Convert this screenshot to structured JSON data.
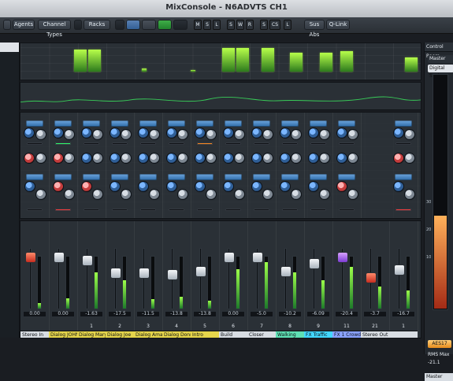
{
  "window": {
    "title": "MixConsole - N6ADVTS CH1"
  },
  "toolbar": {
    "agents": "Agents",
    "channel_types": "Channel Types",
    "racks": "Racks",
    "sus_abs": "Sus Abs",
    "q_link": "Q-Link",
    "mini_buttons": [
      "M",
      "S",
      "L",
      "S",
      "W",
      "R",
      "S",
      "CS",
      "L"
    ]
  },
  "right_panel": {
    "title": "Control Room",
    "master": "Master",
    "meter_type": "Digital Scale",
    "meter_marks": [
      "30",
      "20",
      "10"
    ],
    "aes": "AES17",
    "rms": "RMS Max",
    "rms_value": "-21.1",
    "bottom_label": "Master"
  },
  "channels": [
    {
      "name": "Stereo In",
      "number": "",
      "readout": "0.00",
      "cap": "red",
      "meter": 0.1
    },
    {
      "name": "Dialog JOHN",
      "number": "",
      "readout": "0.00",
      "cap": "white",
      "meter": 0.2
    },
    {
      "name": "Dialog Mary",
      "number": "1",
      "readout": "-1.63",
      "cap": "white",
      "meter": 0.7
    },
    {
      "name": "Dialog Joe",
      "number": "2",
      "readout": "-17.5",
      "cap": "white",
      "meter": 0.55
    },
    {
      "name": "Dialog Amad",
      "number": "3",
      "readout": "-11.5",
      "cap": "white",
      "meter": 0.18
    },
    {
      "name": "Dialog Donny",
      "number": "4",
      "readout": "-13.8",
      "cap": "white",
      "meter": 0.22
    },
    {
      "name": "Intro",
      "number": "5",
      "readout": "-13.8",
      "cap": "white",
      "meter": 0.15
    },
    {
      "name": "Build",
      "number": "6",
      "readout": "0.00",
      "cap": "white",
      "meter": 0.75
    },
    {
      "name": "Closer",
      "number": "7",
      "readout": "-5.0",
      "cap": "white",
      "meter": 0.9
    },
    {
      "name": "Walking",
      "number": "8",
      "readout": "-10.2",
      "cap": "white",
      "meter": 0.7
    },
    {
      "name": "FX Traffic",
      "number": "9",
      "readout": "-6.09",
      "cap": "white",
      "meter": 0.55
    },
    {
      "name": "FX 1 Crowd",
      "number": "11",
      "readout": "-20.4",
      "cap": "purple",
      "meter": 0.8
    },
    {
      "name": "Stereo Out",
      "number": "21",
      "readout": "-3.7",
      "cap": "red",
      "meter": 0.42
    },
    {
      "name": "",
      "number": "1",
      "readout": "-16.7",
      "cap": "white",
      "meter": 0.35
    }
  ]
}
